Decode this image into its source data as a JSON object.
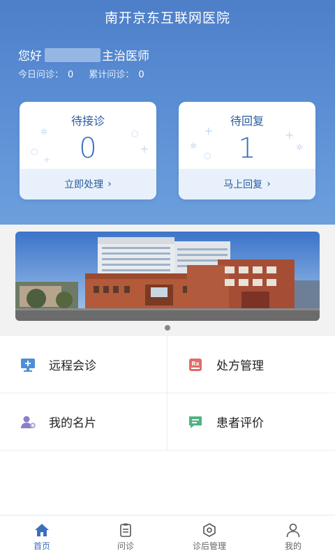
{
  "header": {
    "title": "南开京东互联网医院"
  },
  "user": {
    "greeting": "您好",
    "role_suffix": "主治医师"
  },
  "stats": {
    "today_label": "今日问诊：",
    "today_value": "0",
    "total_label": "累计问诊：",
    "total_value": "0"
  },
  "cards": [
    {
      "title": "待接诊",
      "count": "0",
      "action": "立即处理"
    },
    {
      "title": "待回复",
      "count": "1",
      "action": "马上回复"
    }
  ],
  "banner": {
    "pages": 1,
    "current": 1
  },
  "menu": [
    {
      "label": "远程会诊",
      "icon": "monitor-icon",
      "color": "#4d8fd6"
    },
    {
      "label": "处方管理",
      "icon": "rx-icon",
      "color": "#e06c6c"
    },
    {
      "label": "我的名片",
      "icon": "user-card-icon",
      "color": "#8a7fc9"
    },
    {
      "label": "患者评价",
      "icon": "comment-icon",
      "color": "#4fb383"
    }
  ],
  "tabs": [
    {
      "label": "首页",
      "icon": "home-icon",
      "active": true
    },
    {
      "label": "问诊",
      "icon": "clipboard-icon",
      "active": false
    },
    {
      "label": "诊后管理",
      "icon": "hexagon-icon",
      "active": false
    },
    {
      "label": "我的",
      "icon": "person-icon",
      "active": false
    }
  ],
  "colors": {
    "primary": "#4d7fc9",
    "accent_text": "#2a5a9e",
    "tab_active": "#3a6fbe"
  }
}
